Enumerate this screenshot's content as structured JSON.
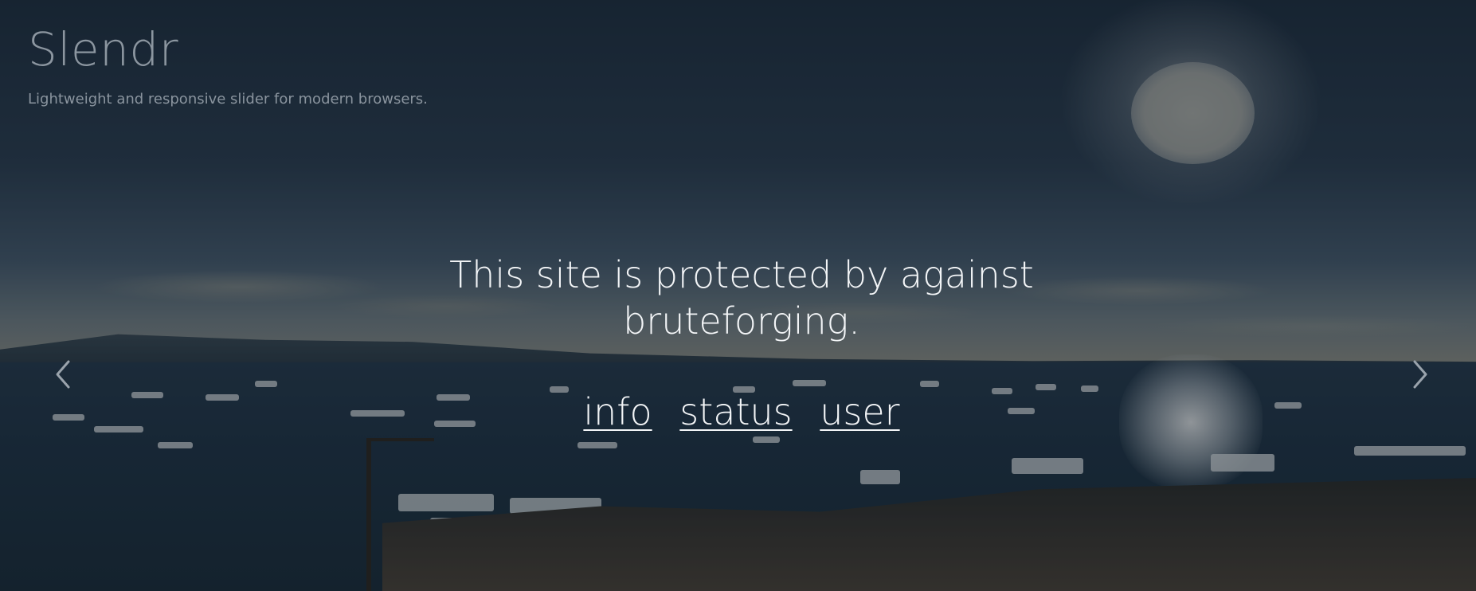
{
  "brand": {
    "title": "Slendr",
    "subtitle": "Lightweight and responsive slider for modern browsers."
  },
  "main": {
    "message": "This site is protected by against bruteforging.",
    "links": [
      {
        "label": "info"
      },
      {
        "label": "status"
      },
      {
        "label": "user"
      }
    ]
  },
  "slider": {
    "prev_icon": "chevron-left-icon",
    "next_icon": "chevron-right-icon"
  },
  "colors": {
    "text": "#f3f5f7",
    "brand_muted": "#8c96a0"
  }
}
